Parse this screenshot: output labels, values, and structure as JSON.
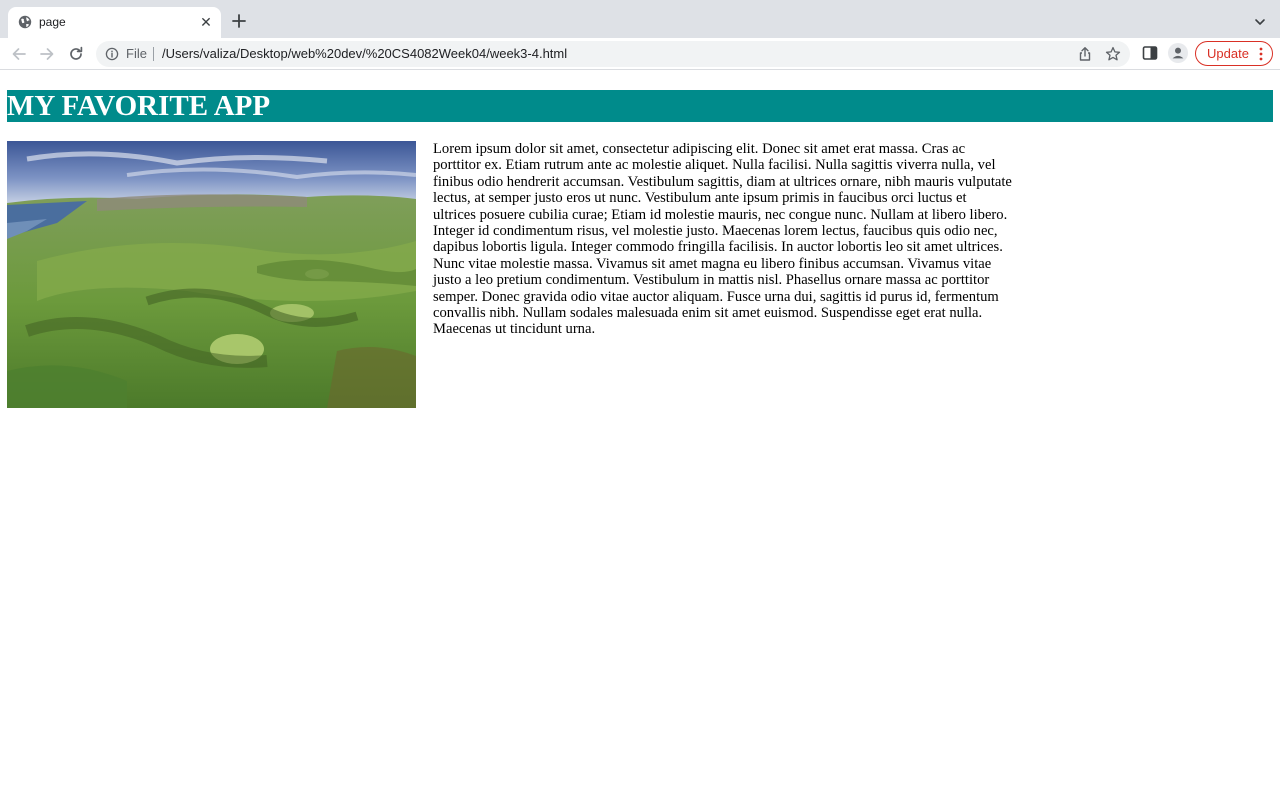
{
  "browser": {
    "tab": {
      "title": "page",
      "favicon": "globe-icon",
      "close_glyph": "✕"
    },
    "new_tab_icon": "plus-icon",
    "tab_search_icon": "chevron-down-icon",
    "nav": {
      "back_icon": "back-arrow-icon",
      "forward_icon": "forward-arrow-icon",
      "reload_icon": "reload-icon"
    },
    "omnibox": {
      "info_icon": "info-icon",
      "scheme_label": "File",
      "url": "/Users/valiza/Desktop/web%20dev/%20CS4082Week04/week3-4.html"
    },
    "actions": {
      "share_icon": "share-icon",
      "bookmark_icon": "star-icon",
      "side_panel_icon": "side-panel-icon",
      "profile_icon": "profile-icon",
      "update_label": "Update",
      "menu_icon": "kebab-menu-icon"
    },
    "accent": "#d93025"
  },
  "page": {
    "title": "MY FAVORITE APP",
    "header_color": "#008b8b",
    "image": "aerial-golf-course-photo",
    "body_text": "Lorem ipsum dolor sit amet, consectetur adipiscing elit. Donec sit amet erat massa. Cras ac porttitor ex. Etiam rutrum ante ac molestie aliquet. Nulla facilisi. Nulla sagittis viverra nulla, vel finibus odio hendrerit accumsan. Vestibulum sagittis, diam at ultrices ornare, nibh mauris vulputate lectus, at semper justo eros ut nunc. Vestibulum ante ipsum primis in faucibus orci luctus et ultrices posuere cubilia curae; Etiam id molestie mauris, nec congue nunc. Nullam at libero libero. Integer id condimentum risus, vel molestie justo. Maecenas lorem lectus, faucibus quis odio nec, dapibus lobortis ligula. Integer commodo fringilla facilisis. In auctor lobortis leo sit amet ultrices. Nunc vitae molestie massa. Vivamus sit amet magna eu libero finibus accumsan. Vivamus vitae justo a leo pretium condimentum. Vestibulum in mattis nisl. Phasellus ornare massa ac porttitor semper. Donec gravida odio vitae auctor aliquam. Fusce urna dui, sagittis id purus id, fermentum convallis nibh. Nullam sodales malesuada enim sit amet euismod. Suspendisse eget erat nulla. Maecenas ut tincidunt urna."
  }
}
